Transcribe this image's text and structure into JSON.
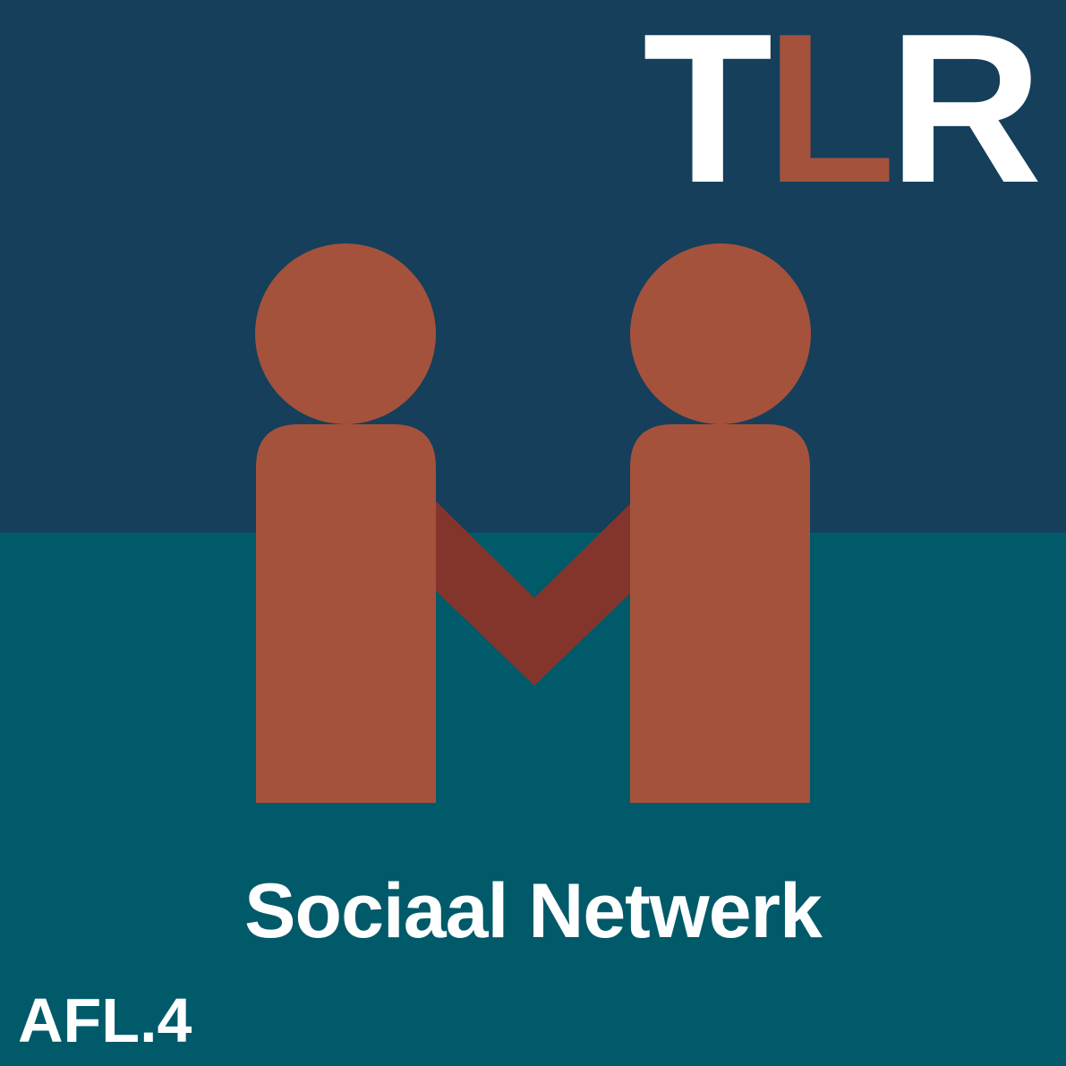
{
  "logo": {
    "letter_1": "T",
    "letter_2": "L",
    "letter_3": "R"
  },
  "artwork": {
    "description_icon": "two-people-holding-hands-icon"
  },
  "title": "Sociaal Netwerk",
  "episode_label": "AFL.4",
  "colors": {
    "navy": "#153f5b",
    "teal": "#005a69",
    "rust": "#a4523c",
    "rust_dark": "#84352b",
    "white": "#ffffff"
  }
}
